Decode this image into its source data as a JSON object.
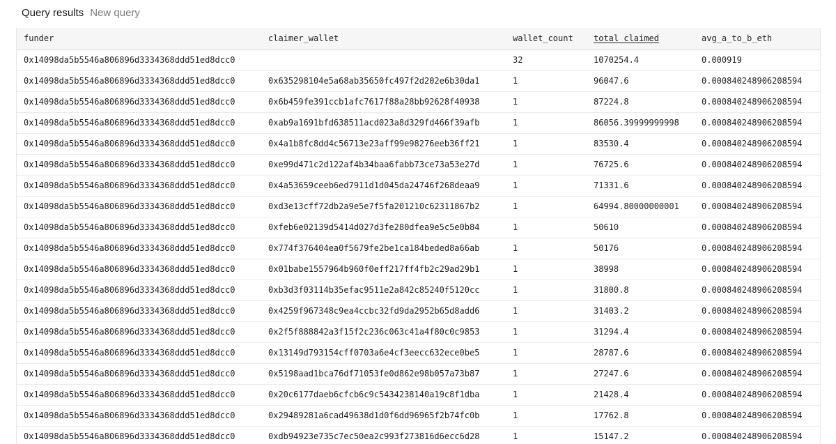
{
  "header": {
    "active_tab": "Query results",
    "inactive_tab": "New query"
  },
  "table": {
    "columns": [
      "funder",
      "claimer_wallet",
      "wallet_count",
      "total_claimed",
      "avg_a_to_b_eth"
    ],
    "sorted_column": "total_claimed",
    "rows": [
      [
        "0x14098da5b5546a806896d3334368ddd51ed8dcc0",
        "",
        "32",
        "1070254.4",
        "0.000919"
      ],
      [
        "0x14098da5b5546a806896d3334368ddd51ed8dcc0",
        "0x635298104e5a68ab35650fc497f2d202e6b30da1",
        "1",
        "96047.6",
        "0.00084024890620859​4"
      ],
      [
        "0x14098da5b5546a806896d3334368ddd51ed8dcc0",
        "0x6b459fe391ccb1afc7617f88a28bb92628f40938",
        "1",
        "87224.8",
        "0.000840248906208594"
      ],
      [
        "0x14098da5b5546a806896d3334368ddd51ed8dcc0",
        "0xab9a1691bfd638511acd023a8d329fd466f39afb",
        "1",
        "86056.39999999998",
        "0.000840248906208594"
      ],
      [
        "0x14098da5b5546a806896d3334368ddd51ed8dcc0",
        "0x4a1b8fc8dd4c56713e23aff99e98276eeb36ff21",
        "1",
        "83530.4",
        "0.000840248906208594"
      ],
      [
        "0x14098da5b5546a806896d3334368ddd51ed8dcc0",
        "0xe99d471c2d122af4b34baa6fabb73ce73a53e27d",
        "1",
        "76725.6",
        "0.000840248906208594"
      ],
      [
        "0x14098da5b5546a806896d3334368ddd51ed8dcc0",
        "0x4a53659ceeb6ed7911d1d045da24746f268deaa9",
        "1",
        "71331.6",
        "0.000840248906208594"
      ],
      [
        "0x14098da5b5546a806896d3334368ddd51ed8dcc0",
        "0xd3e13cff72db2a9e5e7f5fa201210c62311867b2",
        "1",
        "64994.80000000001",
        "0.000840248906208594"
      ],
      [
        "0x14098da5b5546a806896d3334368ddd51ed8dcc0",
        "0xfeb6e02139d5414d027d3fe280dfea9e5c5e0b84",
        "1",
        "50610",
        "0.000840248906208594"
      ],
      [
        "0x14098da5b5546a806896d3334368ddd51ed8dcc0",
        "0x774f376404ea0f5679fe2be1ca184beded8a66ab",
        "1",
        "50176",
        "0.000840248906208594"
      ],
      [
        "0x14098da5b5546a806896d3334368ddd51ed8dcc0",
        "0x01babe1557964b960f0eff217ff4fb2c29ad29b1",
        "1",
        "38998",
        "0.000840248906208594"
      ],
      [
        "0x14098da5b5546a806896d3334368ddd51ed8dcc0",
        "0xb3d3f03114b35efac9511e2a842c85240f5120cc",
        "1",
        "31800.8",
        "0.000840248906208594"
      ],
      [
        "0x14098da5b5546a806896d3334368ddd51ed8dcc0",
        "0x4259f967348c9ea4ccbc32fd9da2952b65d8add6",
        "1",
        "31403.2",
        "0.000840248906208594"
      ],
      [
        "0x14098da5b5546a806896d3334368ddd51ed8dcc0",
        "0x2f5f888842a3f15f2c236c063c41a4f80c0c9853",
        "1",
        "31294.4",
        "0.000840248906208594"
      ],
      [
        "0x14098da5b5546a806896d3334368ddd51ed8dcc0",
        "0x13149d793154cff0703a6e4cf3eecc632ece0be5",
        "1",
        "28787.6",
        "0.000840248906208594"
      ],
      [
        "0x14098da5b5546a806896d3334368ddd51ed8dcc0",
        "0x5198aad1bca76df71053fe0d862e98b057a73b87",
        "1",
        "27247.6",
        "0.000840248906208594"
      ],
      [
        "0x14098da5b5546a806896d3334368ddd51ed8dcc0",
        "0x20c6177daeb6cfcb6c9c5434238140a19c8f1dba",
        "1",
        "21428.4",
        "0.000840248906208594"
      ],
      [
        "0x14098da5b5546a806896d3334368ddd51ed8dcc0",
        "0x29489281a6cad49638d1d0f6dd96965f2b74fc0b",
        "1",
        "17762.8",
        "0.000840248906208594"
      ],
      [
        "0x14098da5b5546a806896d3334368ddd51ed8dcc0",
        "0xdb94923e735c7ec50ea2c993f273816d6ecc6d28",
        "1",
        "15147.2",
        "0.000840248906208594"
      ]
    ]
  }
}
